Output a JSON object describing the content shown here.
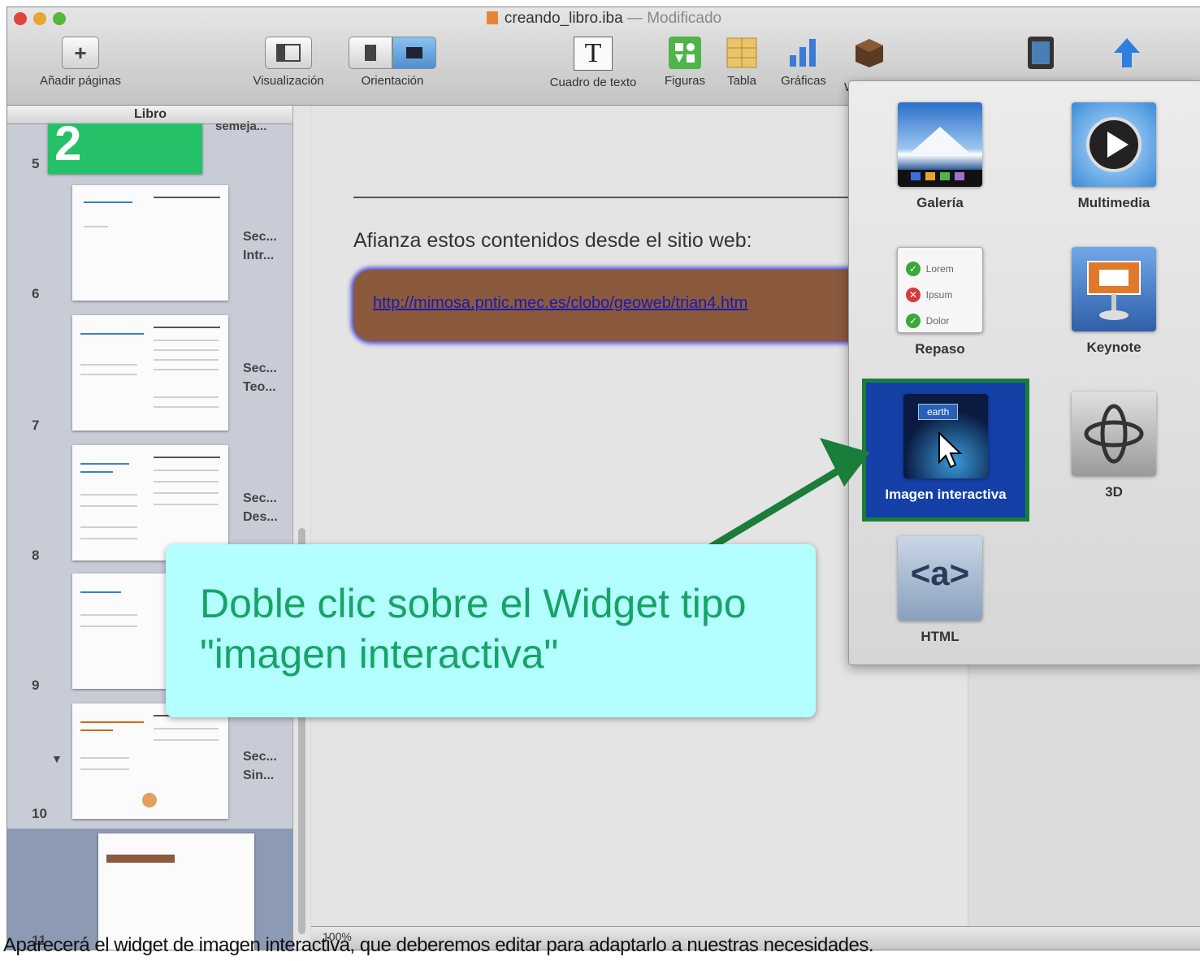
{
  "window": {
    "title": "creando_libro.iba",
    "title_separator": "—",
    "title_status": "Modificado"
  },
  "toolbar": {
    "add_pages": "Añadir páginas",
    "view": "Visualización",
    "orientation": "Orientación",
    "text_box": "Cuadro de texto",
    "shapes": "Figuras",
    "table": "Tabla",
    "charts": "Gráficas",
    "widgets_partial": "W"
  },
  "sidebar": {
    "header": "Libro",
    "top_partial": "semeja...",
    "pages": [
      {
        "num": "5"
      },
      {
        "num": "6",
        "l1": "Sec...",
        "l2": "Intr..."
      },
      {
        "num": "7",
        "l1": "Sec...",
        "l2": "Teo..."
      },
      {
        "num": "8",
        "l1": "Sec...",
        "l2": "Des..."
      },
      {
        "num": "9"
      },
      {
        "num": "10",
        "l1": "Sec...",
        "l2": "Sin..."
      },
      {
        "num": "11"
      }
    ]
  },
  "canvas": {
    "intro": "Afianza estos contenidos desde el sitio web:",
    "link": "http://mimosa.pntic.mec.es/clobo/geoweb/trian4.htm",
    "zoom": "100%"
  },
  "widgets": {
    "gallery": "Galería",
    "multimedia": "Multimedia",
    "review": "Repaso",
    "review_items": [
      "Lorem",
      "Ipsum",
      "Dolor"
    ],
    "keynote": "Keynote",
    "interactive_image": "Imagen interactiva",
    "interactive_tag": "earth",
    "three_d": "3D",
    "html": "HTML",
    "html_glyph": "<a>"
  },
  "callout": {
    "line1": "Doble clic sobre el Widget tipo",
    "line2": "\"imagen interactiva\""
  },
  "caption": "Aparecerá el widget de imagen interactiva, que deberemos editar para adaptarlo a nuestras necesidades."
}
